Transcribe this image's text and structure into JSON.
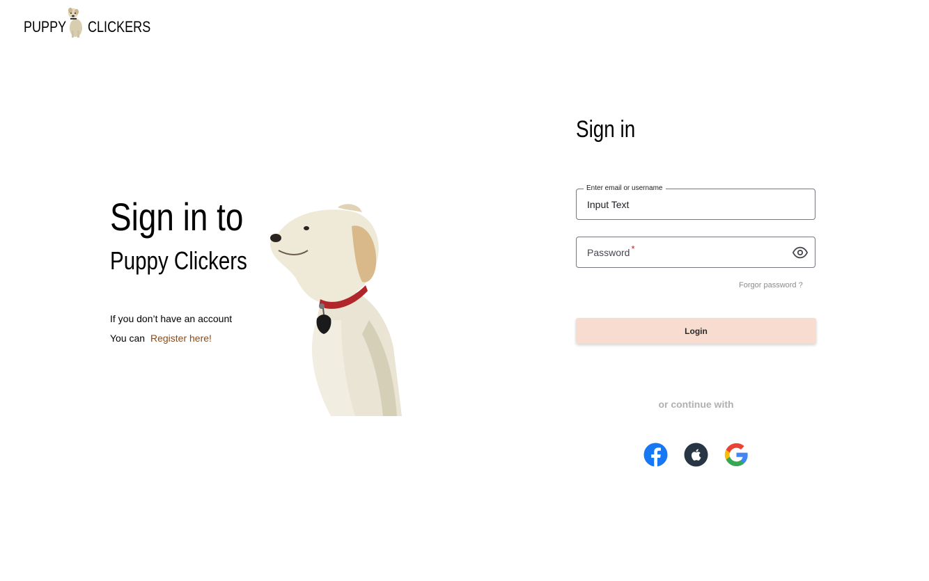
{
  "logo": {
    "word_left": "PUPPY",
    "word_right": "CLICKERS",
    "mascot_icon": "dog-icon"
  },
  "hero": {
    "title": "Sign in to",
    "subtitle": "Puppy Clickers",
    "no_account_text": "If you don’t have an account",
    "you_can_text": "You can",
    "register_link": "Register here!",
    "illustration": "golden-retriever-puppy-image"
  },
  "form": {
    "title": "Sign in",
    "email": {
      "label": "Enter email or username",
      "value": "Input Text"
    },
    "password": {
      "placeholder": "Password",
      "required_marker": "*",
      "toggle_icon": "eye-icon"
    },
    "forgot_password": "Forgor password ?",
    "login_button": "Login",
    "continue_with": "or continue with",
    "social": [
      {
        "name": "facebook",
        "icon": "facebook-icon",
        "color": "#1877f2"
      },
      {
        "name": "apple",
        "icon": "apple-icon",
        "color": "#283544"
      },
      {
        "name": "google",
        "icon": "google-icon",
        "color": "#4285f4"
      }
    ]
  },
  "colors": {
    "login_button_bg": "#f8dccf",
    "register_link": "#8a4b1a",
    "required_star": "#b3261e",
    "muted_text": "#b0b0b0"
  }
}
